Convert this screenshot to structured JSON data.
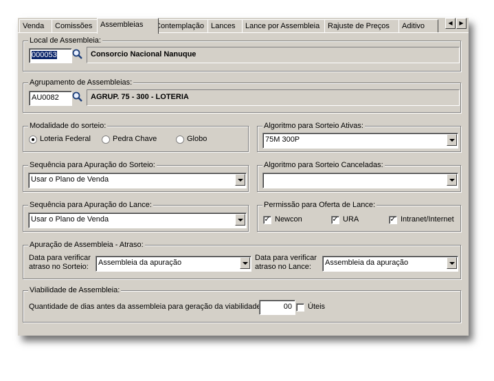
{
  "tabs": [
    "Venda",
    "Comissões",
    "Assembleias",
    "Contemplação",
    "Lances",
    "Lance por Assembleia",
    "Rajuste de Preços",
    "Aditivo"
  ],
  "local": {
    "legend": "Local de Assembleia:",
    "code": "000053",
    "name": "Consorcio Nacional Nanuque"
  },
  "agrupamento": {
    "legend": "Agrupamento de Assembleias:",
    "code": "AU0082",
    "name": "AGRUP. 75 - 300 - LOTERIA"
  },
  "modalidade": {
    "legend": "Modalidade do sorteio:",
    "options": [
      "Loteria Federal",
      "Pedra Chave",
      "Globo"
    ]
  },
  "alg_ativas": {
    "legend": "Algoritmo para Sorteio Ativas:",
    "value": "75M 300P"
  },
  "seq_sorteio": {
    "legend": "Sequência para Apuração do Sorteio:",
    "value": "Usar o Plano de Venda"
  },
  "alg_canceladas": {
    "legend": "Algoritmo para Sorteio Canceladas:",
    "value": ""
  },
  "seq_lance": {
    "legend": "Sequência para Apuração do Lance:",
    "value": "Usar o Plano de Venda"
  },
  "permissao": {
    "legend": "Permissão para Oferta de Lance:",
    "options": [
      "Newcon",
      "URA",
      "Intranet/Internet"
    ]
  },
  "atraso": {
    "legend": "Apuração de Assembleia - Atraso:",
    "sorteio_label_1": "Data para verificar",
    "sorteio_label_2": "atraso no Sorteio:",
    "sorteio_value": "Assembleia da apuração",
    "lance_label_1": "Data para verificar",
    "lance_label_2": "atraso no Lance:",
    "lance_value": "Assembleia da apuração"
  },
  "viabilidade": {
    "legend": "Viabilidade de Assembleia:",
    "label": "Quantidade de dias antes da assembleia para geração da viabilidade:",
    "value": "00",
    "uteis": "Úteis"
  }
}
